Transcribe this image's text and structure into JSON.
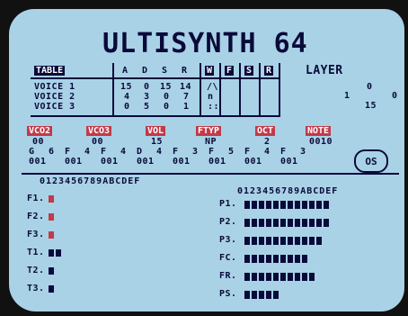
{
  "app": {
    "title": "ULTISYNTH 64",
    "layer_label": "LAYER",
    "layer_values": [
      "0",
      "1",
      "0",
      "15"
    ]
  },
  "table": {
    "label": "TABLE",
    "headers": [
      "A",
      "D",
      "S",
      "R",
      "W",
      "F",
      "S",
      "R"
    ],
    "voices": [
      {
        "label": "VOICE 1",
        "a": "15",
        "d": "0",
        "s": "15",
        "r": "14"
      },
      {
        "label": "VOICE 2",
        "a": "4",
        "d": "3",
        "s": "0",
        "r": "7"
      },
      {
        "label": "VOICE 3",
        "a": "0",
        "d": "5",
        "s": "0",
        "r": "1"
      }
    ],
    "wave_glyphs": [
      "/\\",
      "n",
      "::"
    ]
  },
  "params": {
    "labels": [
      "VCO2",
      "VCO3",
      "VOL",
      "FTYP",
      "OCT",
      "NOTE"
    ],
    "values": [
      "00",
      "00",
      "15",
      "NP",
      "2",
      "0010"
    ],
    "note_row_top": [
      "G",
      "F",
      "F",
      "D",
      "F",
      "F",
      "F",
      "F"
    ],
    "note_row_sub": [
      "6",
      "4",
      "4",
      "4",
      "3",
      "5",
      "4",
      "3"
    ],
    "note_row_bottom": [
      "001",
      "001",
      "001",
      "001",
      "001",
      "001",
      "001",
      "001"
    ],
    "os_label": "OS"
  },
  "patterns_left": {
    "scale": "0123456789ABCDEF",
    "rows": [
      {
        "label": "F1.",
        "kind": "red",
        "count": 1
      },
      {
        "label": "F2.",
        "kind": "red",
        "count": 1
      },
      {
        "label": "F3.",
        "kind": "red",
        "count": 1
      },
      {
        "label": "T1.",
        "kind": "blue",
        "count": 2
      },
      {
        "label": "T2.",
        "kind": "blue",
        "count": 1
      },
      {
        "label": "T3.",
        "kind": "blue",
        "count": 1
      }
    ]
  },
  "patterns_right": {
    "scale": "0123456789ABCDEF",
    "rows": [
      {
        "label": "P1.",
        "count": 12
      },
      {
        "label": "P2.",
        "count": 12
      },
      {
        "label": "P3.",
        "count": 11
      },
      {
        "label": "FC.",
        "count": 9
      },
      {
        "label": "FR.",
        "count": 10
      },
      {
        "label": "PS.",
        "count": 5
      }
    ]
  }
}
